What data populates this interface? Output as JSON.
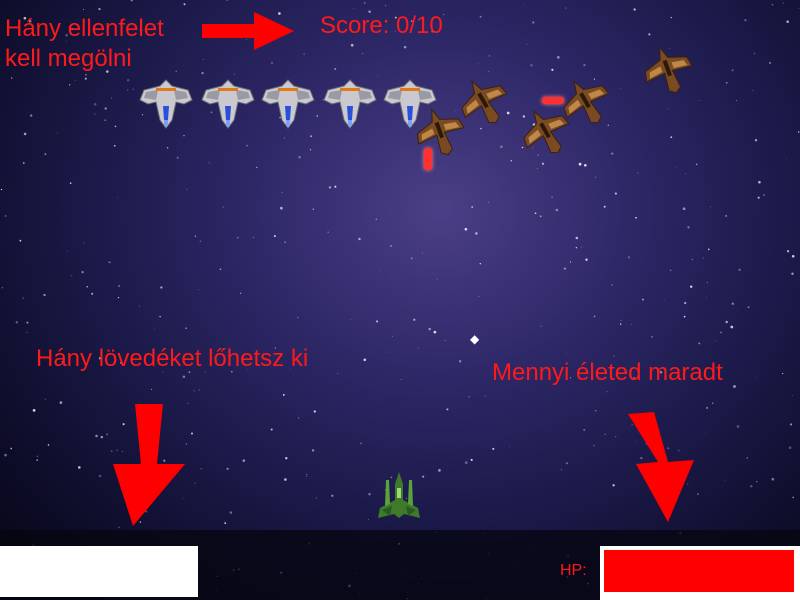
{
  "hud": {
    "score_text": "Score: 0/10",
    "hp_label": "HP:",
    "hp_level": 1.0,
    "ammo_level": 1.0
  },
  "annotations": {
    "enemies_line1": "Hány ellenfelet",
    "enemies_line2": "kell megölni",
    "ammo": "Hány lövedéket lőhetsz ki",
    "lives": "Mennyi életed maradt"
  },
  "colors": {
    "annotation_red": "#ff1a1a",
    "hp_red": "#ff0000",
    "space_bg": "#2e2868"
  },
  "icons": {
    "formation_ship": "silver-fighter-icon",
    "enemy_ship": "bronze-fighter-icon",
    "player_ship": "green-fighter-icon",
    "pointer": "red-arrow-icon"
  }
}
